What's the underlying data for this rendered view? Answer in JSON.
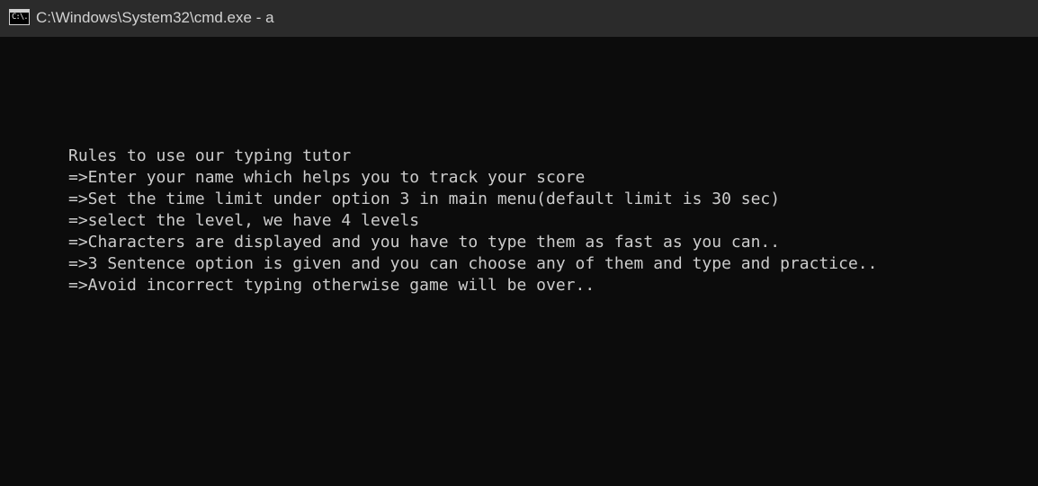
{
  "window": {
    "title": "C:\\Windows\\System32\\cmd.exe - a",
    "icon": "cmd-icon",
    "icon_glyph": "C:\\."
  },
  "console": {
    "lines": [
      "Rules to use our typing tutor",
      "=>Enter your name which helps you to track your score",
      "=>Set the time limit under option 3 in main menu(default limit is 30 sec)",
      "=>select the level, we have 4 levels",
      "=>Characters are displayed and you have to type them as fast as you can..",
      "=>3 Sentence option is given and you can choose any of them and type and practice..",
      "=>Avoid incorrect typing otherwise game will be over.."
    ]
  },
  "colors": {
    "background": "#0c0c0c",
    "titlebar": "#2b2b2b",
    "text": "#cccccc"
  }
}
